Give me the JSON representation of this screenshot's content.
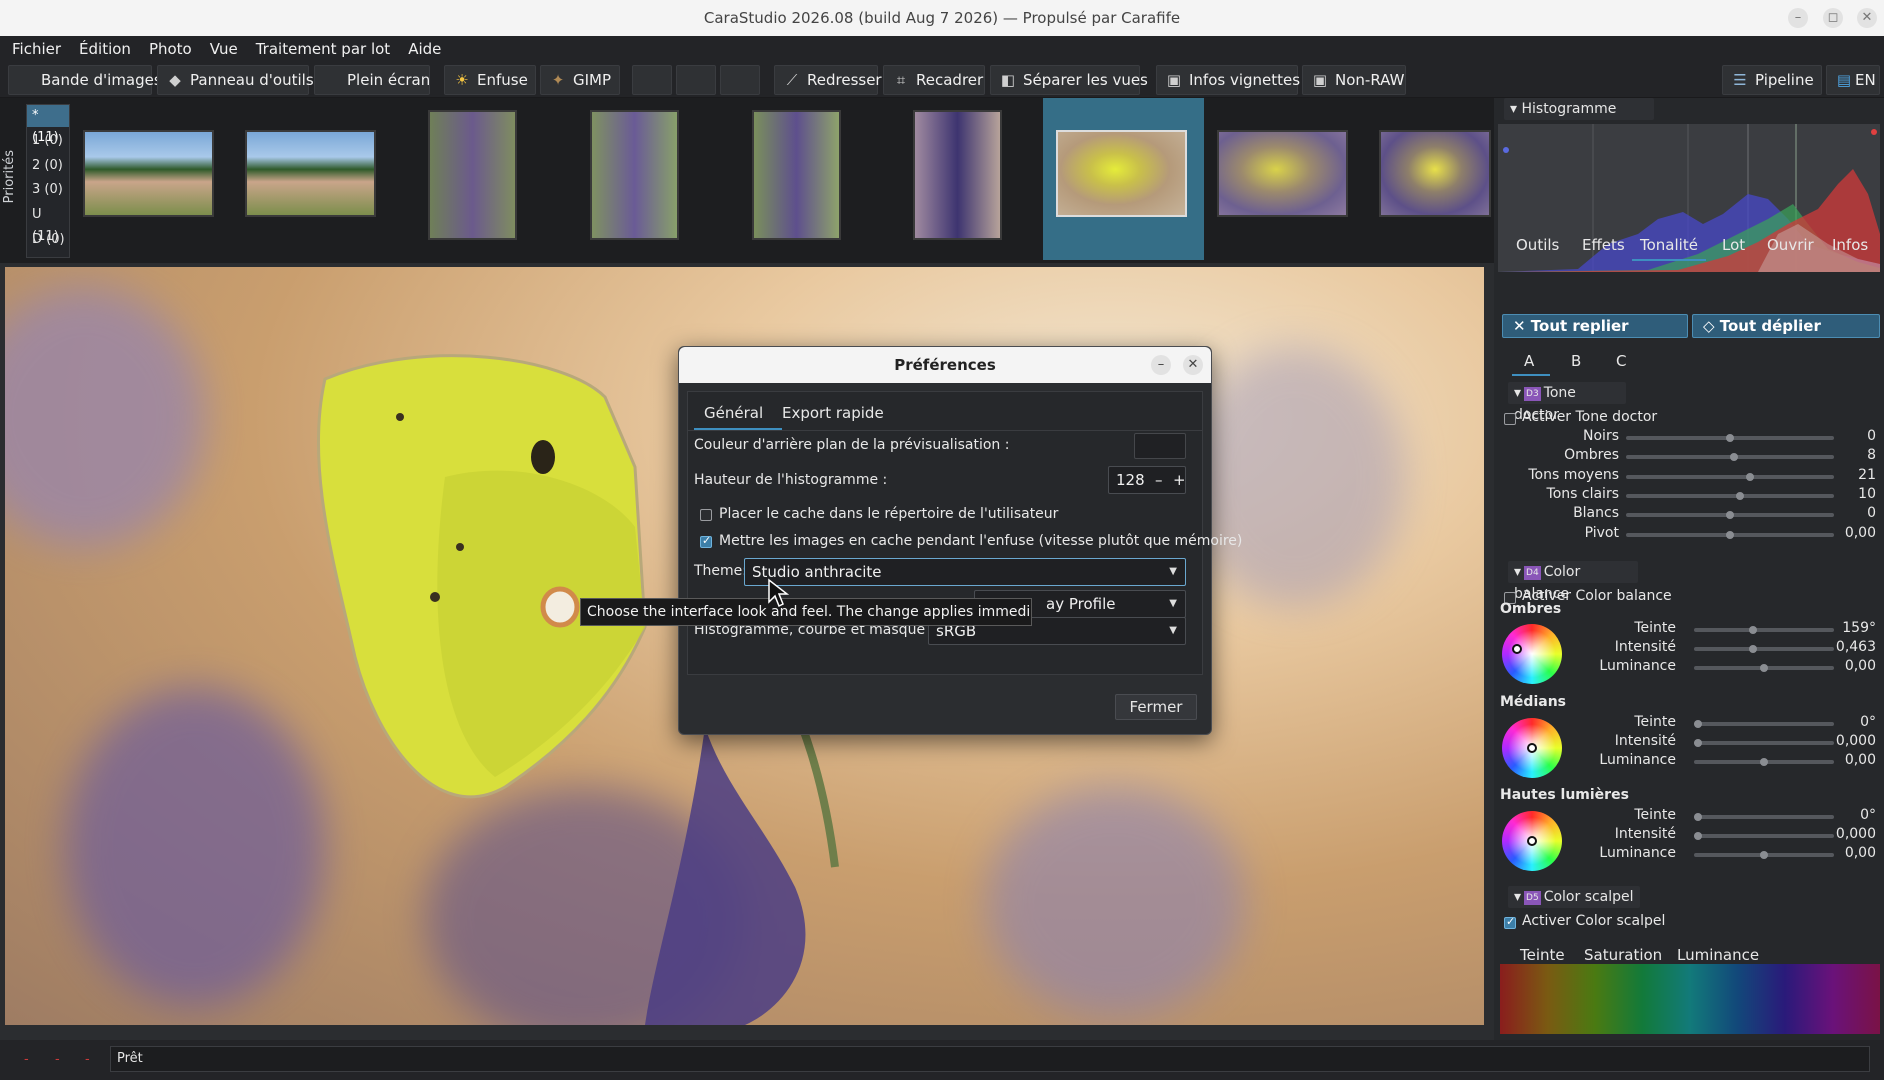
{
  "window": {
    "title": "CaraStudio 2026.08 (build Aug  7 2026) — Propulsé par Carafife",
    "controls": [
      "–",
      "◻",
      "✕"
    ]
  },
  "menu": [
    "Fichier",
    "Édition",
    "Photo",
    "Vue",
    "Traitement par lot",
    "Aide"
  ],
  "toolbar": {
    "filmstrip": "Bande d'images",
    "tools_panel": "Panneau d'outils",
    "fullscreen": "Plein écran",
    "enfuse": "Enfuse",
    "gimp": "GIMP",
    "straighten": "Redresser",
    "crop": "Recadrer",
    "split_views": "Séparer les vues",
    "thumb_info": "Infos vignettes",
    "non_raw": "Non-RAW",
    "pipeline": "Pipeline",
    "lang": "EN"
  },
  "filmstrip": {
    "priorities_label": "Priorités",
    "priorities": [
      "* (11)",
      "1 (0)",
      "2 (0)",
      "3 (0)",
      "U (11)",
      "D (0)"
    ]
  },
  "histogram": {
    "title": "Histogramme"
  },
  "panel_tabs": [
    "Outils",
    "Effets",
    "Tonalité",
    "Lot",
    "Ouvrir",
    "Infos"
  ],
  "collapse_all": "✕ Tout replier",
  "expand_all": "◇ Tout déplier",
  "abc_tabs": [
    "A",
    "B",
    "C"
  ],
  "tone_doctor": {
    "title": "Tone doctor",
    "badge": "D3",
    "enable": "Activer Tone doctor",
    "rows": [
      {
        "label": "Noirs",
        "value": "0",
        "pos": 0.5
      },
      {
        "label": "Ombres",
        "value": "8",
        "pos": 0.52
      },
      {
        "label": "Tons moyens",
        "value": "21",
        "pos": 0.6
      },
      {
        "label": "Tons clairs",
        "value": "10",
        "pos": 0.55
      },
      {
        "label": "Blancs",
        "value": "0",
        "pos": 0.5
      },
      {
        "label": "Pivot",
        "value": "0,00",
        "pos": 0.5
      }
    ]
  },
  "color_balance": {
    "title": "Color balance",
    "badge": "D4",
    "enable": "Activer Color balance",
    "groups": [
      {
        "name": "Ombres",
        "rows": [
          {
            "label": "Teinte",
            "value": "159°"
          },
          {
            "label": "Intensité",
            "value": "0,463"
          },
          {
            "label": "Luminance",
            "value": "0,00"
          }
        ]
      },
      {
        "name": "Médians",
        "rows": [
          {
            "label": "Teinte",
            "value": "0°"
          },
          {
            "label": "Intensité",
            "value": "0,000"
          },
          {
            "label": "Luminance",
            "value": "0,00"
          }
        ]
      },
      {
        "name": "Hautes lumières",
        "rows": [
          {
            "label": "Teinte",
            "value": "0°"
          },
          {
            "label": "Intensité",
            "value": "0,000"
          },
          {
            "label": "Luminance",
            "value": "0,00"
          }
        ]
      }
    ]
  },
  "color_scalpel": {
    "title": "Color scalpel",
    "badge": "D5",
    "enable": "Activer Color scalpel",
    "tabs": [
      "Teinte",
      "Saturation",
      "Luminance"
    ]
  },
  "dialog": {
    "title": "Préférences",
    "tabs": [
      "Général",
      "Export rapide"
    ],
    "bg_color_label": "Couleur d'arrière plan de la prévisualisation :",
    "hist_height_label": "Hauteur de l'histogramme :",
    "hist_height_value": "128",
    "cache_home_label": "Placer le cache dans le répertoire de l'utilisateur",
    "cache_enfuse_label": "Mettre les images en cache pendant l'enfuse (vitesse plutôt que mémoire)",
    "theme_label": "Theme:",
    "theme_value": "Studio anthracite",
    "display_profile_value": "ay Profile",
    "hist_curve_label": "Histogramme, courbe et masque d'expo. :",
    "hist_curve_value": "sRGB",
    "close_button": "Fermer",
    "minus": "–",
    "plus": "+"
  },
  "tooltip": "Choose the interface look and feel. The change applies immediately.",
  "status": {
    "text": "Prêt",
    "dashes": [
      "-",
      "-",
      "-"
    ]
  },
  "colors": {
    "accent": "#3e6e8c",
    "selected_thumb": "#356e87"
  }
}
